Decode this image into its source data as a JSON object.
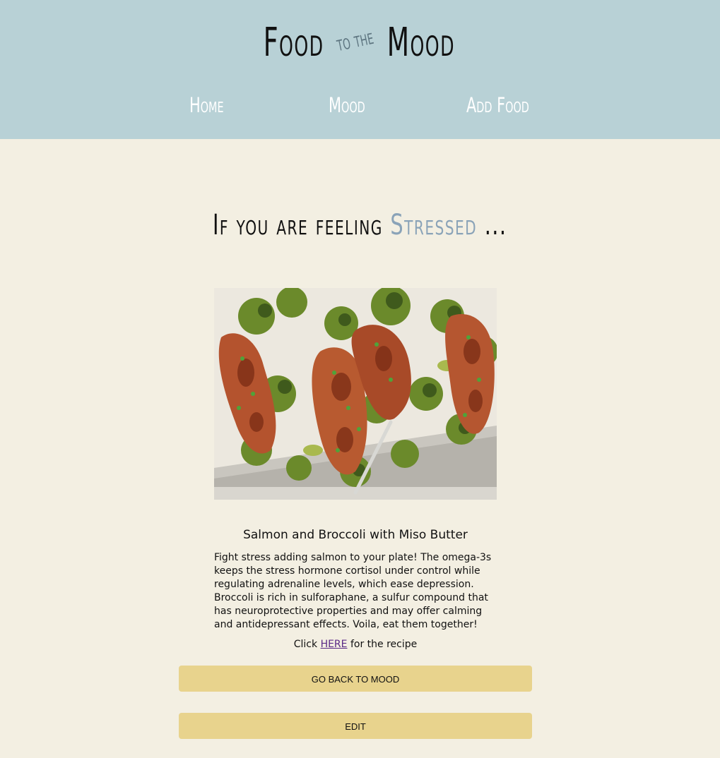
{
  "header": {
    "logo": {
      "word1": "Food",
      "connector": "to the",
      "word2": "Mood"
    },
    "nav": [
      {
        "label": "Home"
      },
      {
        "label": "Mood"
      },
      {
        "label": "Add Food"
      }
    ]
  },
  "main": {
    "heading_prefix": "If you are feeling",
    "heading_mood": "Stressed",
    "heading_suffix": "...",
    "food": {
      "title": "Salmon and Broccoli with Miso Butter",
      "description": "Fight stress adding salmon to your plate! The omega-3s keeps the stress hormone cortisol under control while regulating adrenaline levels, which ease depression. Broccoli is rich in sulforaphane, a sulfur compound that has neuroprotective properties and may offer calming and antidepressant effects. Voila, eat them together!",
      "recipe_prefix": "Click",
      "recipe_link": "HERE",
      "recipe_suffix": "for the recipe"
    },
    "buttons": {
      "back": "GO BACK TO MOOD",
      "edit": "EDIT"
    }
  },
  "colors": {
    "header_bg": "#b8d1d6",
    "page_bg": "#f3efe2",
    "mood_accent": "#8aa3b8",
    "button_bg": "#e8d38d"
  }
}
